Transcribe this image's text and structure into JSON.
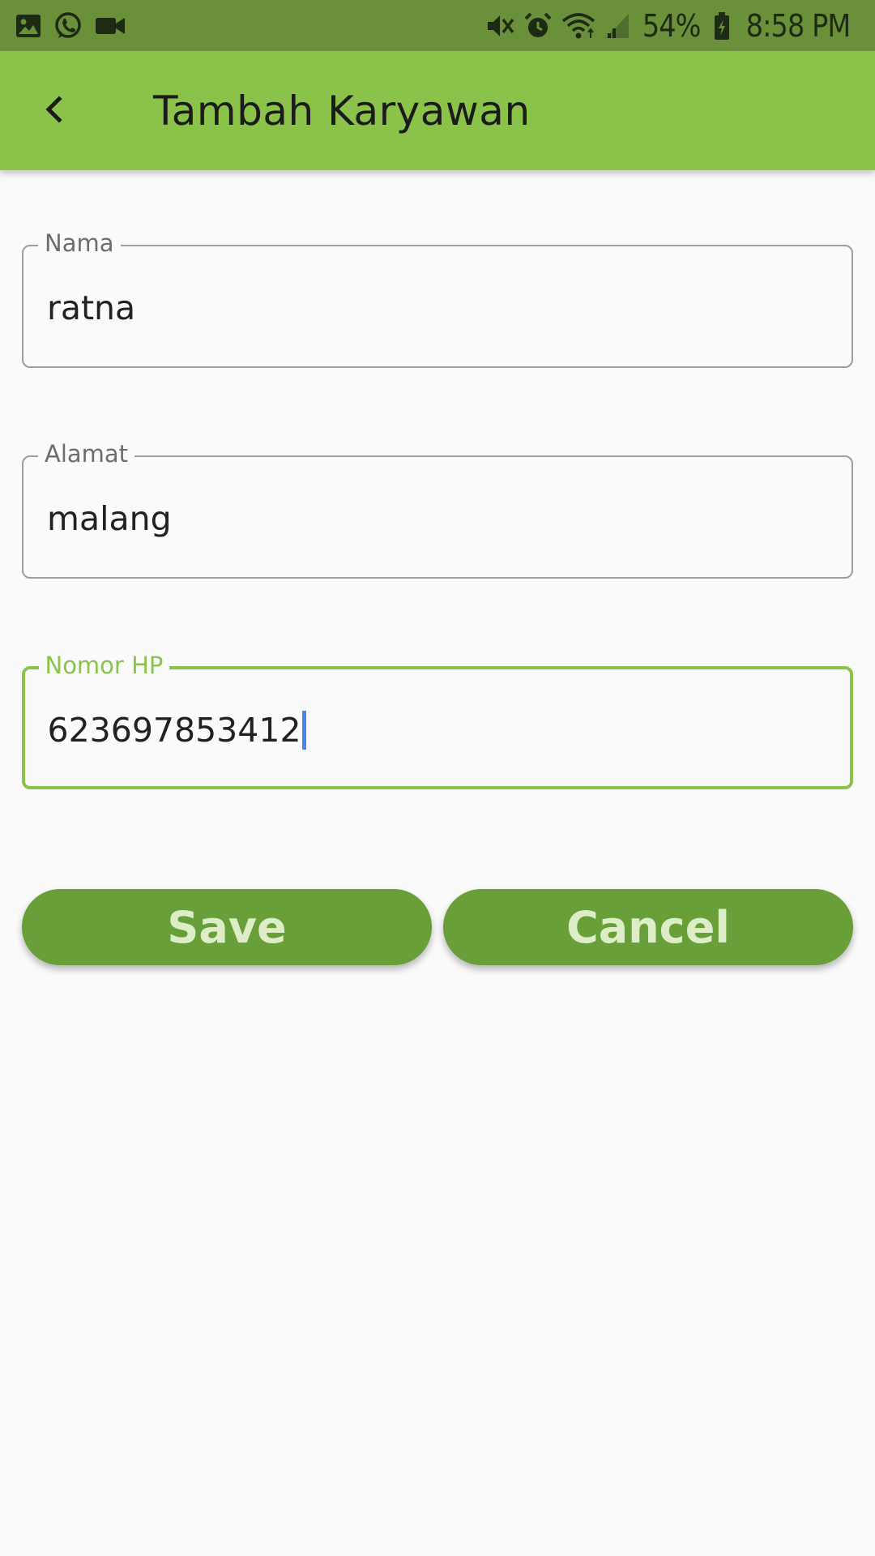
{
  "status_bar": {
    "battery_percent": "54%",
    "time": "8:58 PM",
    "left_icons": [
      "gallery-icon",
      "whatsapp-icon",
      "video-camera-icon"
    ],
    "right_icons": [
      "vibrate-icon",
      "alarm-icon",
      "wifi-icon",
      "signal-icon",
      "battery-icon"
    ]
  },
  "app_bar": {
    "title": "Tambah Karyawan",
    "back_icon": "chevron-left-icon",
    "background": "#8bc34a"
  },
  "form": {
    "name": {
      "label": "Nama",
      "value": "ratna"
    },
    "address": {
      "label": "Alamat",
      "value": "malang"
    },
    "phone": {
      "label": "Nomor HP",
      "value": "623697853412",
      "focused": true
    }
  },
  "buttons": {
    "save_label": "Save",
    "cancel_label": "Cancel",
    "color": "#689f38",
    "text_color": "#dcedc8"
  },
  "colors": {
    "accent": "#8bc34a",
    "status_bar": "#6a913a",
    "caret": "#4a86e8"
  }
}
